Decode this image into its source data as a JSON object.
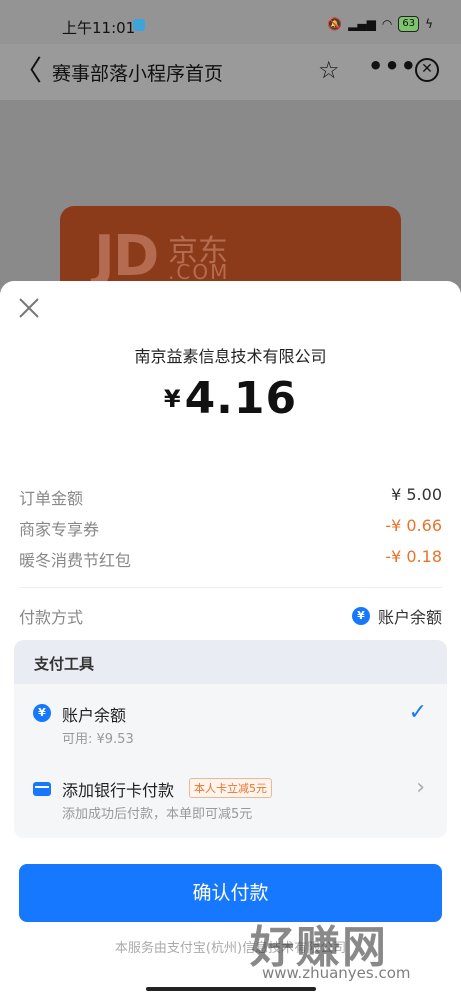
{
  "status_bar": {
    "time": "上午11:01",
    "battery": "63"
  },
  "nav": {
    "back_glyph": "〈",
    "title": "赛事部落小程序首页",
    "star_glyph": "☆",
    "more_glyph": "•••",
    "close_glyph": "✕"
  },
  "background": {
    "jd_logo": "JD",
    "jd_cn": "京东",
    "jd_com": ".COM"
  },
  "sheet": {
    "merchant": "南京益素信息技术有限公司",
    "currency": "¥",
    "amount": "4.16",
    "order_lines": [
      {
        "label": "订单金额",
        "value": "¥ 5.00"
      },
      {
        "label": "商家专享券",
        "value": "-¥ 0.66"
      },
      {
        "label": "暖冬消费节红包",
        "value": "-¥ 0.18"
      }
    ],
    "payment_method": {
      "label": "付款方式",
      "value": "账户余额",
      "icon": "yen-icon"
    },
    "pay_tool": {
      "title": "支付工具",
      "balance": {
        "title": "账户余额",
        "sub": "可用: ¥9.53",
        "icon": "yen-icon"
      },
      "bank_card": {
        "title": "添加银行卡付款",
        "promo": "本人卡立减5元",
        "sub": "添加成功后付款，本单即可减5元",
        "icon": "card-icon"
      }
    },
    "confirm_label": "确认付款",
    "footer_note": "本服务由支付宝(杭州)信息技术有限公司",
    "watermark": "好赚网",
    "watermark_sub": "www.zhuanyes.com"
  },
  "colors": {
    "accent": "#1677ff",
    "discount": "#e8742c"
  }
}
